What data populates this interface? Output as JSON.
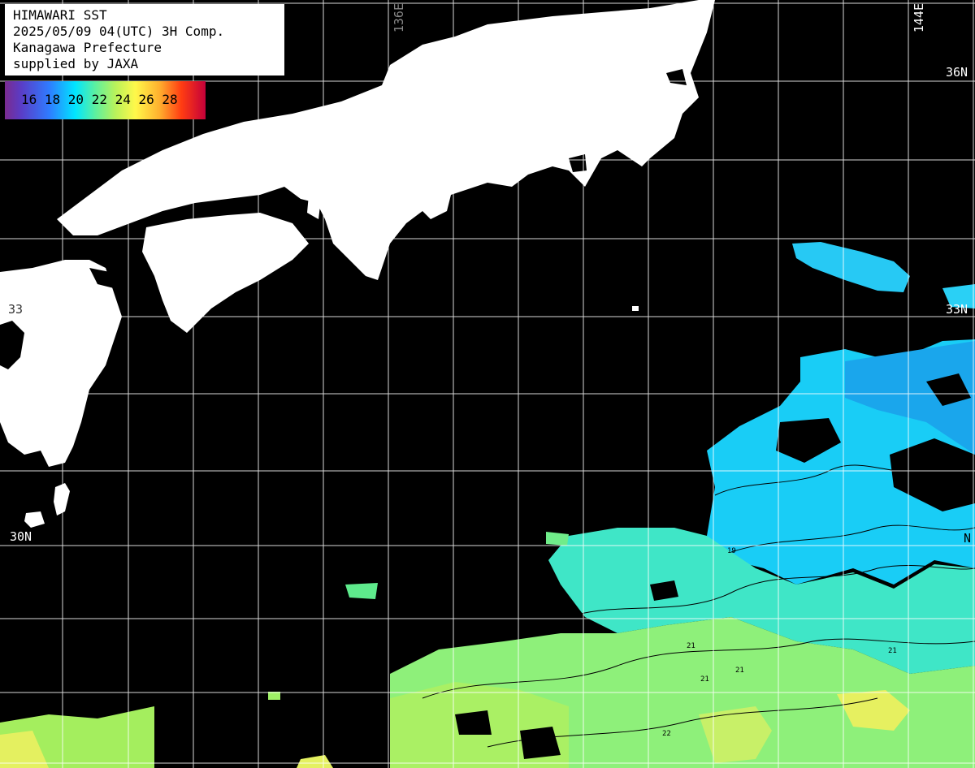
{
  "header": {
    "line1": "HIMAWARI SST",
    "line2": "2025/05/09 04(UTC) 3H Comp.",
    "line3": "Kanagawa Prefecture",
    "line4": "supplied by JAXA"
  },
  "legend": {
    "labels": "16 18 20 22 24 26 28",
    "colors": [
      "#7a2b8f",
      "#5a3cc6",
      "#2f7bff",
      "#00e5ff",
      "#5cf0a0",
      "#b8f25b",
      "#fff84a",
      "#ffb02e",
      "#ff3c12",
      "#c4003a"
    ]
  },
  "grid_labels": {
    "lon_136": "136E",
    "lon_144": "144E",
    "lat_36": "36N",
    "lat_33_right": "33N",
    "lat_33_left": "33",
    "lat_30_left": "30N",
    "lat_30_right": "N"
  },
  "contour_labels": [
    "19",
    "21",
    "21",
    "21",
    "22",
    "21"
  ],
  "colors": {
    "land": "#ffffff",
    "no_data": "#000000",
    "grid": "#ffffff",
    "sst_cool": "#1ec8ff",
    "sst_mid": "#40e8c0",
    "sst_warm": "#9af06a",
    "sst_warmer": "#e6f060"
  }
}
